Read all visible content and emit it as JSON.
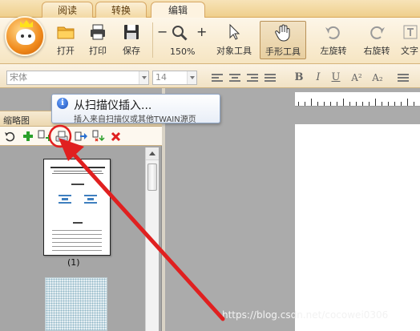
{
  "ribbon_tabs": [
    "阅读",
    "转换",
    "编辑"
  ],
  "active_tab": "编辑",
  "ribbon": {
    "open": "打开",
    "print": "打印",
    "save": "保存",
    "zoom_out": "−",
    "zoom_in": "+",
    "zoom_level": "150%",
    "object_tool": "对象工具",
    "hand_tool": "手形工具",
    "rotate_left": "左旋转",
    "rotate_right": "右旋转",
    "text": "文字"
  },
  "format_bar": {
    "font_name": "宋体",
    "font_size": "14",
    "bold": "B",
    "italic": "I",
    "underline": "U",
    "superscript": "A²",
    "subscript": "A₂"
  },
  "tooltip": {
    "title": "从扫描仪插入...",
    "description": "插入来自扫描仪或其他TWAIN源页"
  },
  "thumbnail_panel": {
    "title": "缩略图",
    "pages": [
      {
        "caption": "(1)"
      }
    ]
  },
  "watermark": "https://blog.csdn.net/cocowei0306",
  "colors": {
    "annotation_red": "#e02020",
    "ribbon_bg": "#f6e5c2",
    "workspace_gray": "#ababab"
  }
}
